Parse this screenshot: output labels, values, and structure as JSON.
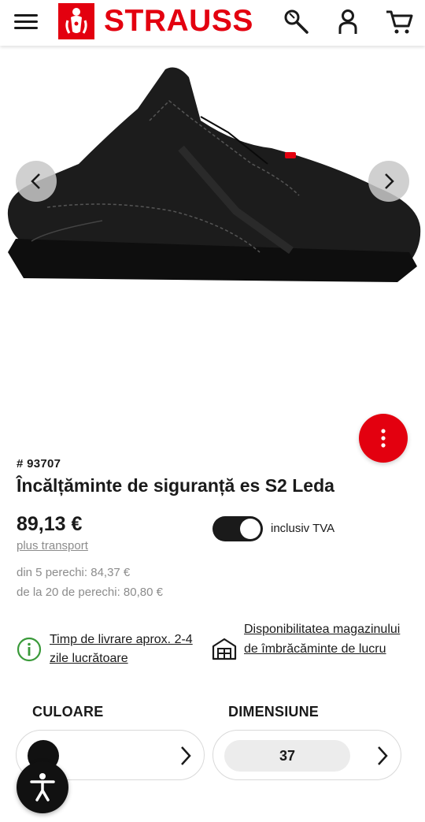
{
  "header": {
    "brand": "STRAUSS",
    "icons": [
      "menu-icon",
      "tools-search-icon",
      "user-icon",
      "cart-icon"
    ]
  },
  "product": {
    "sku": "# 93707",
    "title": "Încălțăminte de siguranță es S2 Leda",
    "price": "89,13 €",
    "shipping": "plus transport",
    "vat_label": "inclusiv TVA",
    "vat_toggle_on": true,
    "tiers": [
      "din 5 perechi: 84,37 €",
      "de la 20 de perechi: 80,80 €"
    ],
    "delivery": "Timp de livrare aprox. 2-4 zile lucrătoare",
    "store_availability": "Disponibilitatea magazinului de îmbrăcăminte de lucru"
  },
  "selectors": {
    "color_label": "CULOARE",
    "color_value": "black",
    "size_label": "DIMENSIUNE",
    "size_value": "37"
  },
  "colors": {
    "brand_red": "#e3000f",
    "dark": "#1a1a1a",
    "muted": "#8c8c8c"
  }
}
